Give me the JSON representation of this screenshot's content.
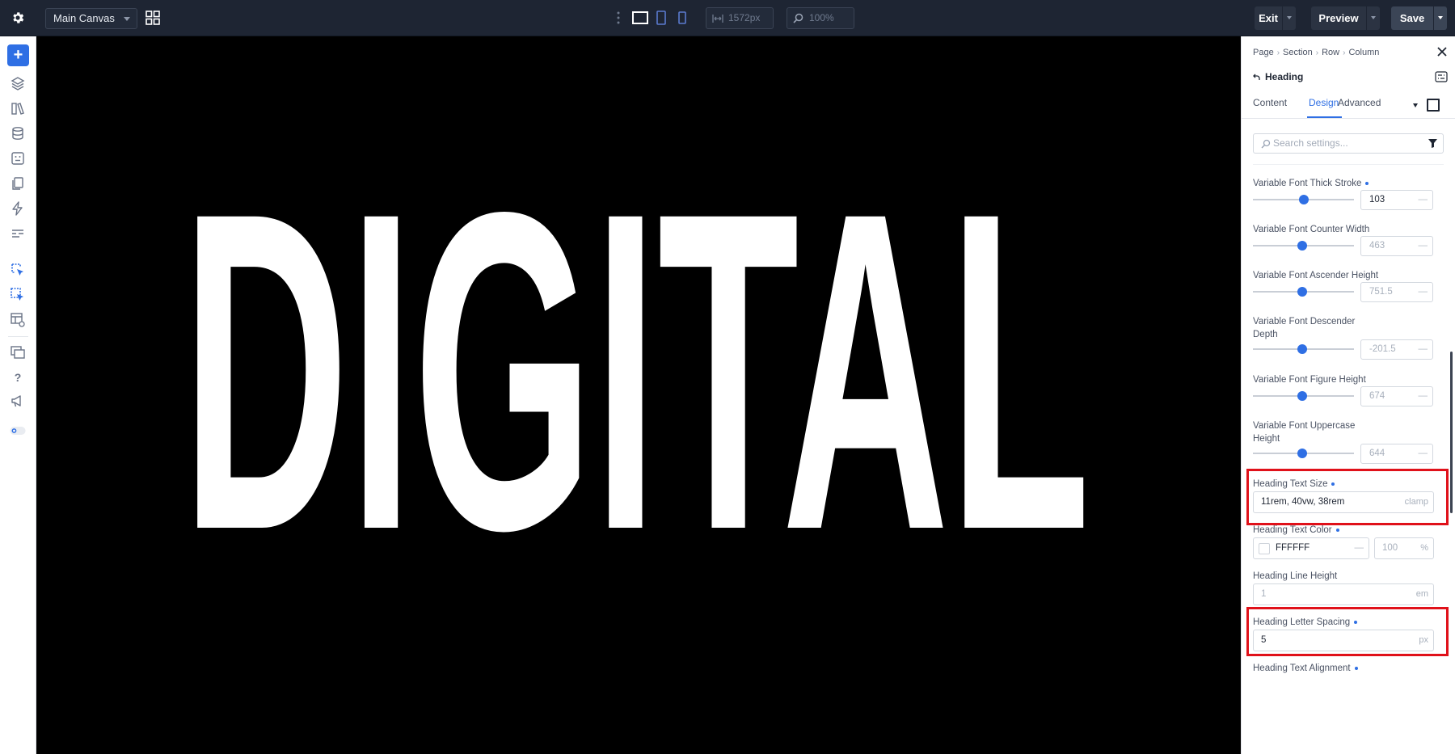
{
  "topbar": {
    "canvas_select": "Main Canvas",
    "width_value": "1572px",
    "zoom_value": "100%",
    "exit_label": "Exit",
    "preview_label": "Preview",
    "save_label": "Save"
  },
  "canvas": {
    "heading_text": "DIGITAL",
    "heading_color": "#FFFFFF",
    "background_color": "#000000"
  },
  "panel": {
    "breadcrumb": [
      "Page",
      "Section",
      "Row",
      "Column"
    ],
    "element_title": "Heading",
    "tabs": [
      "Content",
      "Design",
      "Advanced"
    ],
    "active_tab": "Design",
    "search_placeholder": "Search settings...",
    "settings": {
      "thick_stroke": {
        "label": "Variable Font Thick Stroke",
        "value": "103"
      },
      "counter_width": {
        "label": "Variable Font Counter Width",
        "value": "463"
      },
      "ascender_height": {
        "label": "Variable Font Ascender Height",
        "value": "751.5"
      },
      "descender_depth": {
        "label_line1": "Variable Font Descender",
        "label_line2": "Depth",
        "value": "-201.5"
      },
      "figure_height": {
        "label": "Variable Font Figure Height",
        "value": "674"
      },
      "uppercase_height": {
        "label_line1": "Variable Font Uppercase",
        "label_line2": "Height",
        "value": "644"
      },
      "text_size": {
        "label": "Heading Text Size",
        "value": "11rem, 40vw, 38rem",
        "unit": "clamp"
      },
      "text_color": {
        "label": "Heading Text Color",
        "value": "FFFFFF",
        "opacity": "100",
        "unit": "%"
      },
      "line_height": {
        "label": "Heading Line Height",
        "value": "1",
        "unit": "em"
      },
      "letter_spacing": {
        "label": "Heading Letter Spacing",
        "value": "5",
        "unit": "px"
      },
      "text_alignment": {
        "label": "Heading Text Alignment"
      }
    },
    "slider_levels": {
      "thick_stroke": 0.5,
      "counter_width": 0.49,
      "ascender_height": 0.49,
      "descender_depth": 0.49,
      "figure_height": 0.49,
      "uppercase_height": 0.49
    },
    "accent_color": "#2F6FE4",
    "highlight_color": "#E0111A"
  }
}
